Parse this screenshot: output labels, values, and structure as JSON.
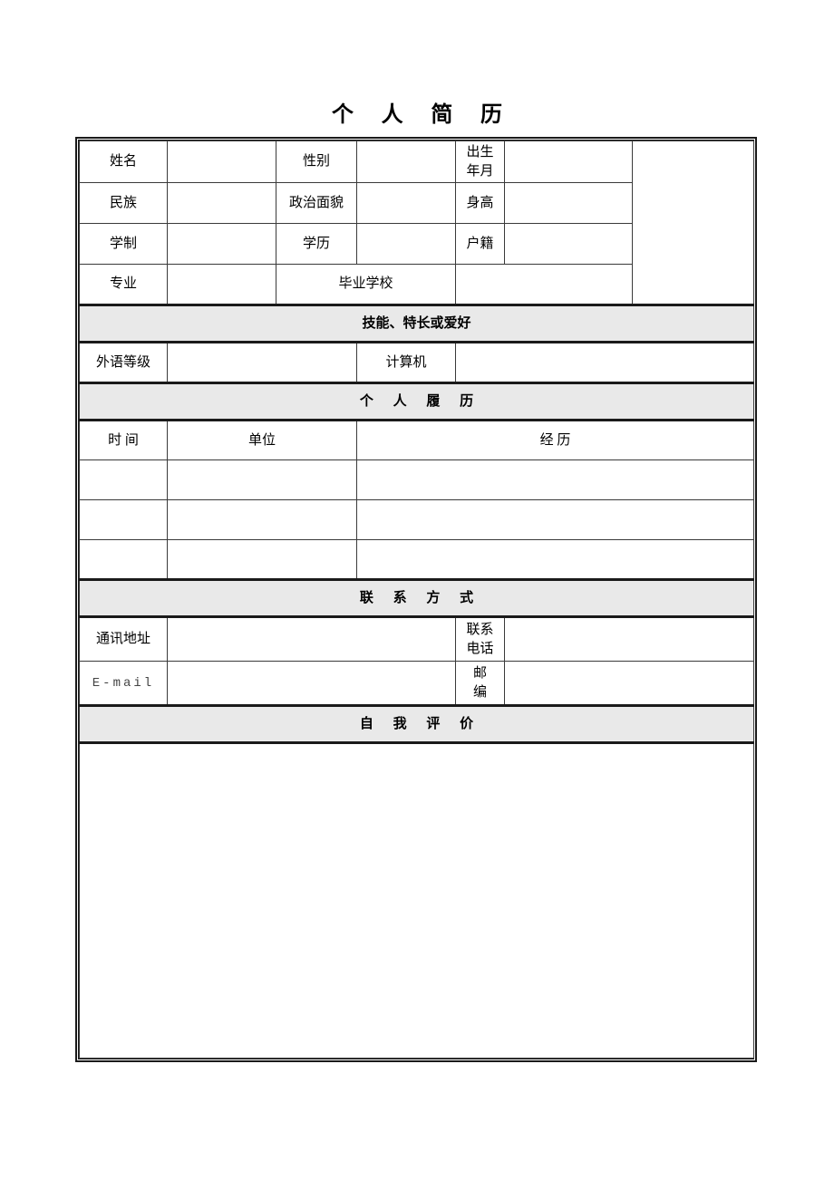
{
  "document": {
    "title": "个  人  简  历"
  },
  "basic_info": {
    "rows": [
      {
        "label1": "姓名",
        "value1": "",
        "label2": "性别",
        "value2": "",
        "label3": "出生\n年月",
        "value3": ""
      },
      {
        "label1": "民族",
        "value1": "",
        "label2": "政治面貌",
        "value2": "",
        "label3": "身高",
        "value3": ""
      },
      {
        "label1": "学制",
        "value1": "",
        "label2": "学历",
        "value2": "",
        "label3": "户籍",
        "value3": ""
      }
    ],
    "major_row": {
      "label": "专业",
      "value": "",
      "school_label": "毕业学校",
      "school_value": ""
    },
    "photo_placeholder": ""
  },
  "sections": {
    "skills_header": "技能、特长或爱好",
    "resume_header": "个 人 履 历",
    "contact_header": "联 系 方 式",
    "self_eval_header": "自 我 评 价"
  },
  "skills": {
    "foreign_language_label": "外语等级",
    "foreign_language_value": "",
    "computer_label": "计算机",
    "computer_value": ""
  },
  "experience": {
    "headers": {
      "time": "时  间",
      "unit": "单位",
      "experience": "经  历"
    },
    "rows": [
      {
        "time": "",
        "unit": "",
        "experience": ""
      },
      {
        "time": "",
        "unit": "",
        "experience": ""
      },
      {
        "time": "",
        "unit": "",
        "experience": ""
      }
    ]
  },
  "contact": {
    "address_label": "通讯地址",
    "address_value": "",
    "phone_label": "联系\n电话",
    "phone_value": "",
    "email_label": "E-mail",
    "email_value": "",
    "postcode_label": "邮\n编",
    "postcode_value": ""
  },
  "self_evaluation": {
    "content": ""
  },
  "colors": {
    "section_header_bg": "#e9e9e9",
    "border": "#1a1a1a",
    "inner_border": "#3a3a3a",
    "text": "#000000",
    "page_bg": "#ffffff"
  }
}
